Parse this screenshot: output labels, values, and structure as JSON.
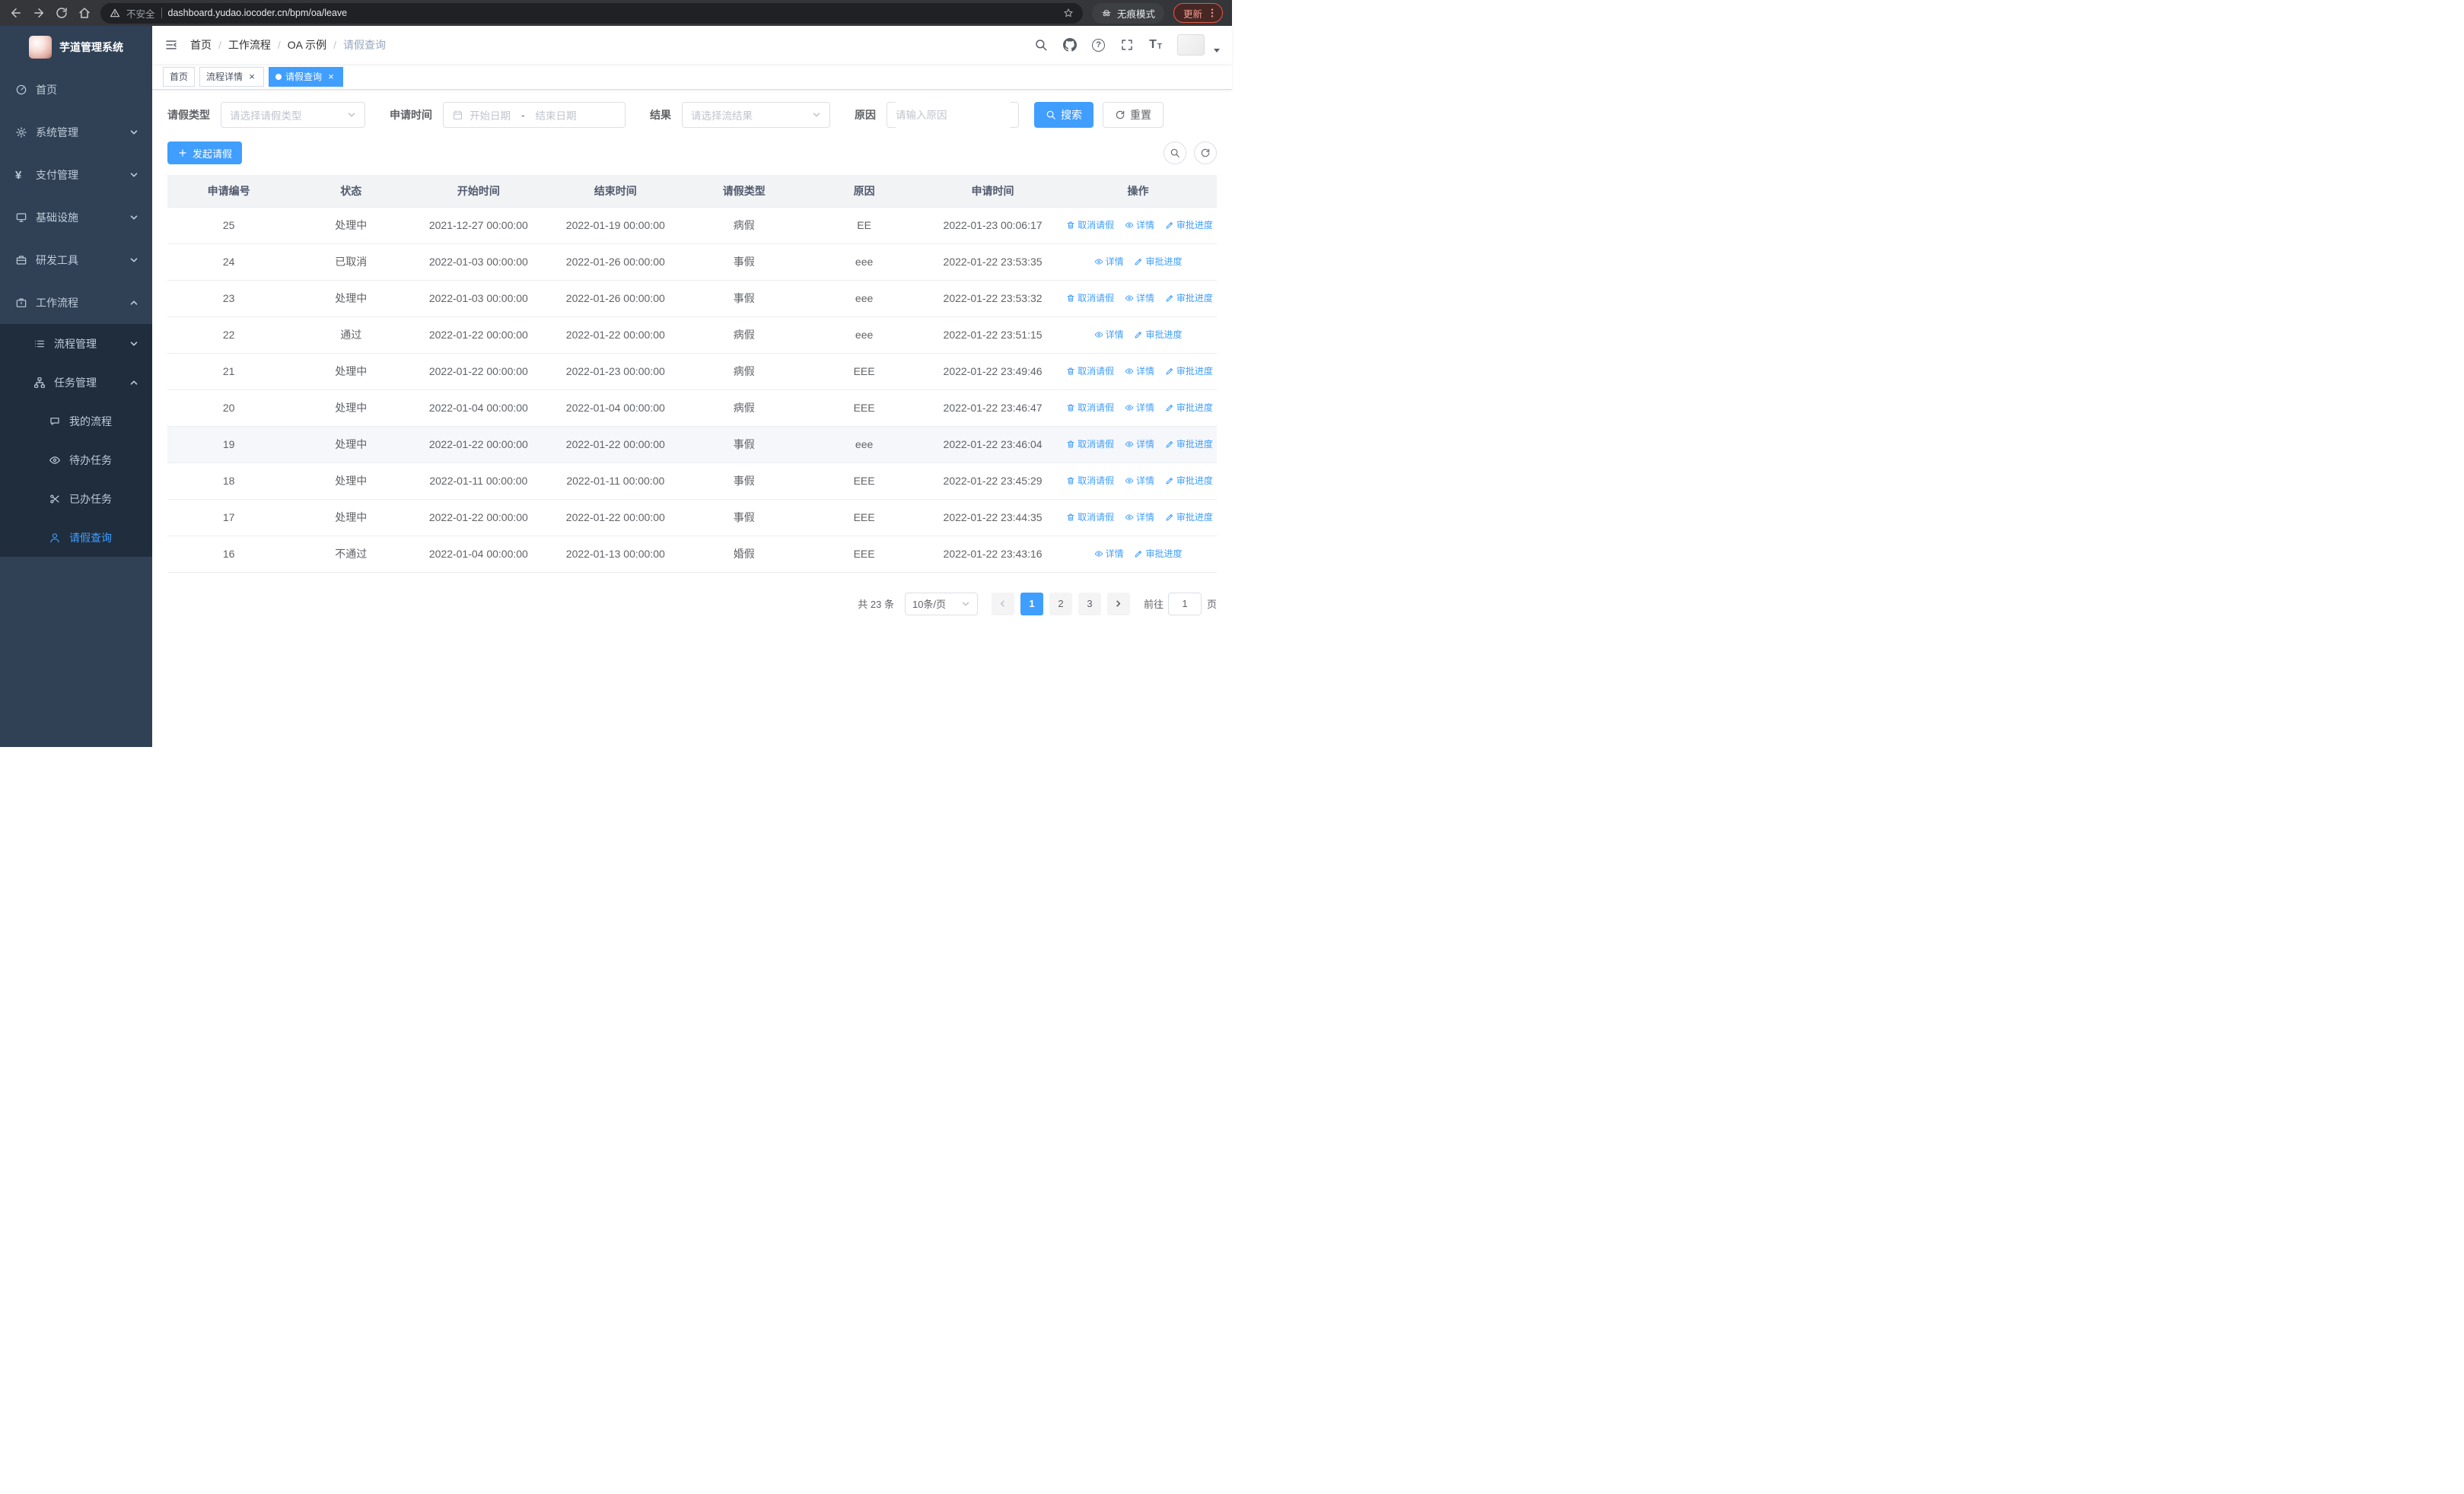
{
  "theme": {
    "primary": "#409eff",
    "sidebar_bg": "#304156",
    "submenu_bg": "#1f2d3d"
  },
  "browser": {
    "security_label": "不安全",
    "url": "dashboard.yudao.iocoder.cn/bpm/oa/leave",
    "incognito_label": "无痕模式",
    "update_label": "更新"
  },
  "sidebar": {
    "app_title": "芋道管理系统",
    "items": [
      {
        "label": "首页",
        "level": 0
      },
      {
        "label": "系统管理",
        "level": 0,
        "arrow": "down"
      },
      {
        "label": "支付管理",
        "level": 0,
        "arrow": "down"
      },
      {
        "label": "基础设施",
        "level": 0,
        "arrow": "down"
      },
      {
        "label": "研发工具",
        "level": 0,
        "arrow": "down"
      },
      {
        "label": "工作流程",
        "level": 0,
        "arrow": "up",
        "expanded": true
      },
      {
        "label": "流程管理",
        "level": 1,
        "arrow": "down"
      },
      {
        "label": "任务管理",
        "level": 1,
        "arrow": "up",
        "expanded": true
      },
      {
        "label": "我的流程",
        "level": 2
      },
      {
        "label": "待办任务",
        "level": 2
      },
      {
        "label": "已办任务",
        "level": 2
      },
      {
        "label": "请假查询",
        "level": 2,
        "active": true
      }
    ]
  },
  "header": {
    "breadcrumb": [
      "首页",
      "工作流程",
      "OA 示例",
      "请假查询"
    ]
  },
  "tabs": [
    {
      "label": "首页",
      "closable": false,
      "active": false
    },
    {
      "label": "流程详情",
      "closable": true,
      "active": false
    },
    {
      "label": "请假查询",
      "closable": true,
      "active": true
    }
  ],
  "filters": {
    "leave_type_label": "请假类型",
    "leave_type_placeholder": "请选择请假类型",
    "apply_time_label": "申请时间",
    "start_date_placeholder": "开始日期",
    "date_separator": "-",
    "end_date_placeholder": "结束日期",
    "result_label": "结果",
    "result_placeholder": "请选择流结果",
    "reason_label": "原因",
    "reason_placeholder": "请输入原因",
    "search_label": "搜索",
    "reset_label": "重置"
  },
  "toolbar": {
    "create_label": "发起请假"
  },
  "table": {
    "columns": [
      "申请编号",
      "状态",
      "开始时间",
      "结束时间",
      "请假类型",
      "原因",
      "申请时间",
      "操作"
    ],
    "action_labels": {
      "cancel": "取消请假",
      "detail": "详情",
      "progress": "审批进度"
    },
    "rows": [
      {
        "id": "25",
        "status": "处理中",
        "start": "2021-12-27 00:00:00",
        "end": "2022-01-19 00:00:00",
        "type": "病假",
        "reason": "EE",
        "apply_time": "2022-01-23 00:06:17",
        "can_cancel": true,
        "highlighted": false
      },
      {
        "id": "24",
        "status": "已取消",
        "start": "2022-01-03 00:00:00",
        "end": "2022-01-26 00:00:00",
        "type": "事假",
        "reason": "eee",
        "apply_time": "2022-01-22 23:53:35",
        "can_cancel": false,
        "highlighted": false
      },
      {
        "id": "23",
        "status": "处理中",
        "start": "2022-01-03 00:00:00",
        "end": "2022-01-26 00:00:00",
        "type": "事假",
        "reason": "eee",
        "apply_time": "2022-01-22 23:53:32",
        "can_cancel": true,
        "highlighted": false
      },
      {
        "id": "22",
        "status": "通过",
        "start": "2022-01-22 00:00:00",
        "end": "2022-01-22 00:00:00",
        "type": "病假",
        "reason": "eee",
        "apply_time": "2022-01-22 23:51:15",
        "can_cancel": false,
        "highlighted": false
      },
      {
        "id": "21",
        "status": "处理中",
        "start": "2022-01-22 00:00:00",
        "end": "2022-01-23 00:00:00",
        "type": "病假",
        "reason": "EEE",
        "apply_time": "2022-01-22 23:49:46",
        "can_cancel": true,
        "highlighted": false
      },
      {
        "id": "20",
        "status": "处理中",
        "start": "2022-01-04 00:00:00",
        "end": "2022-01-04 00:00:00",
        "type": "病假",
        "reason": "EEE",
        "apply_time": "2022-01-22 23:46:47",
        "can_cancel": true,
        "highlighted": false
      },
      {
        "id": "19",
        "status": "处理中",
        "start": "2022-01-22 00:00:00",
        "end": "2022-01-22 00:00:00",
        "type": "事假",
        "reason": "eee",
        "apply_time": "2022-01-22 23:46:04",
        "can_cancel": true,
        "highlighted": true
      },
      {
        "id": "18",
        "status": "处理中",
        "start": "2022-01-11 00:00:00",
        "end": "2022-01-11 00:00:00",
        "type": "事假",
        "reason": "EEE",
        "apply_time": "2022-01-22 23:45:29",
        "can_cancel": true,
        "highlighted": false
      },
      {
        "id": "17",
        "status": "处理中",
        "start": "2022-01-22 00:00:00",
        "end": "2022-01-22 00:00:00",
        "type": "事假",
        "reason": "EEE",
        "apply_time": "2022-01-22 23:44:35",
        "can_cancel": true,
        "highlighted": false
      },
      {
        "id": "16",
        "status": "不通过",
        "start": "2022-01-04 00:00:00",
        "end": "2022-01-13 00:00:00",
        "type": "婚假",
        "reason": "EEE",
        "apply_time": "2022-01-22 23:43:16",
        "can_cancel": false,
        "highlighted": false
      }
    ]
  },
  "pagination": {
    "total_label": "共 23 条",
    "page_size": "10条/页",
    "pages": [
      "1",
      "2",
      "3"
    ],
    "active_page": "1",
    "goto_label": "前往",
    "goto_value": "1",
    "page_unit": "页"
  }
}
